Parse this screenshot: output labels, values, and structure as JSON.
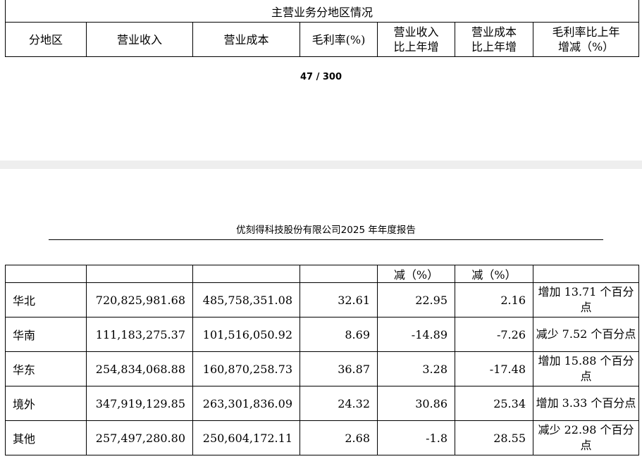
{
  "top_table": {
    "title": "主营业务分地区情况",
    "headers": [
      "分地区",
      "营业收入",
      "营业成本",
      "毛利率(%)",
      "营业收入\n比上年增",
      "营业成本\n比上年增",
      "毛利率比上年\n增减（%）"
    ]
  },
  "page_number": "47 / 300",
  "report_header": "优刻得科技股份有限公司2025 年年度报告",
  "bottom_table": {
    "continuation": [
      "",
      "",
      "",
      "",
      "减（%）",
      "减（%）",
      ""
    ],
    "rows": [
      {
        "region": "华北",
        "revenue": "720,825,981.68",
        "cost": "485,758,351.08",
        "margin": "32.61",
        "revenue_change": "22.95",
        "cost_change": "2.16",
        "margin_change": "增加 13.71 个百分点"
      },
      {
        "region": "华南",
        "revenue": "111,183,275.37",
        "cost": "101,516,050.92",
        "margin": "8.69",
        "revenue_change": "-14.89",
        "cost_change": "-7.26",
        "margin_change": "减少 7.52 个百分点"
      },
      {
        "region": "华东",
        "revenue": "254,834,068.88",
        "cost": "160,870,258.73",
        "margin": "36.87",
        "revenue_change": "3.28",
        "cost_change": "-17.48",
        "margin_change": "增加 15.88 个百分点"
      },
      {
        "region": "境外",
        "revenue": "347,919,129.85",
        "cost": "263,301,836.09",
        "margin": "24.32",
        "revenue_change": "30.86",
        "cost_change": "25.34",
        "margin_change": "增加 3.33 个百分点"
      },
      {
        "region": "其他",
        "revenue": "257,497,280.80",
        "cost": "250,604,172.11",
        "margin": "2.68",
        "revenue_change": "-1.8",
        "cost_change": "28.55",
        "margin_change": "减少 22.98 个百分点"
      }
    ]
  }
}
